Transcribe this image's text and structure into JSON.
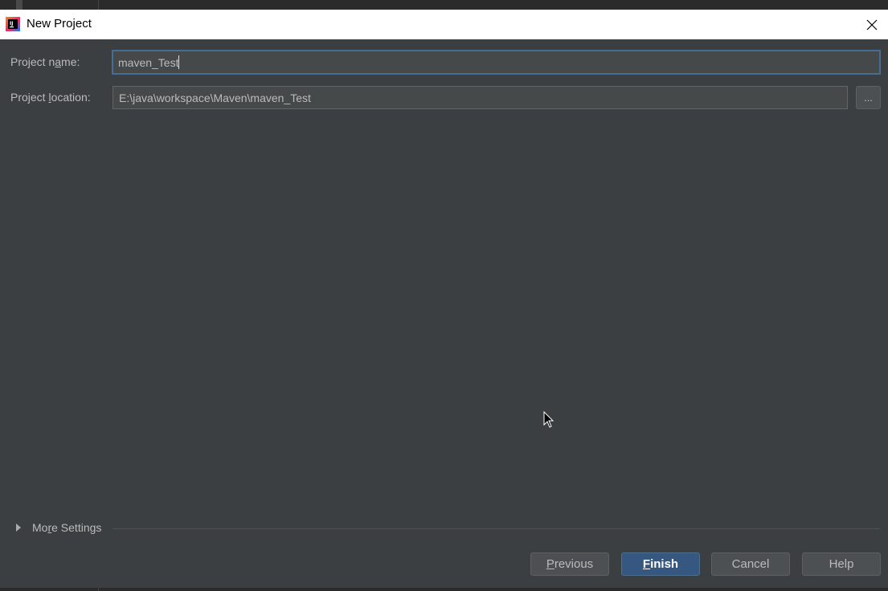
{
  "window": {
    "title": "New Project",
    "icon": "intellij-idea-icon",
    "close_icon": "close-icon"
  },
  "form": {
    "project_name": {
      "label_prefix": "Project n",
      "label_mnemonic": "a",
      "label_suffix": "me:",
      "value": "maven_Test"
    },
    "project_location": {
      "label_prefix": "Project ",
      "label_mnemonic": "l",
      "label_suffix": "ocation:",
      "value": "E:\\java\\workspace\\Maven\\maven_Test",
      "browse_label": "..."
    }
  },
  "more_settings": {
    "label_prefix": "Mo",
    "label_mnemonic": "r",
    "label_suffix": "e Settings",
    "icon": "expand-arrow-icon"
  },
  "buttons": {
    "previous": {
      "mnemonic": "P",
      "rest": "revious"
    },
    "finish": {
      "mnemonic": "F",
      "rest": "inish"
    },
    "cancel": {
      "label": "Cancel"
    },
    "help": {
      "label": "Help"
    }
  },
  "colors": {
    "dialog_bg": "#3c3f41",
    "field_bg": "#45494a",
    "focus_border": "#466d94",
    "primary_button": "#365880",
    "text": "#bbbbbb"
  }
}
